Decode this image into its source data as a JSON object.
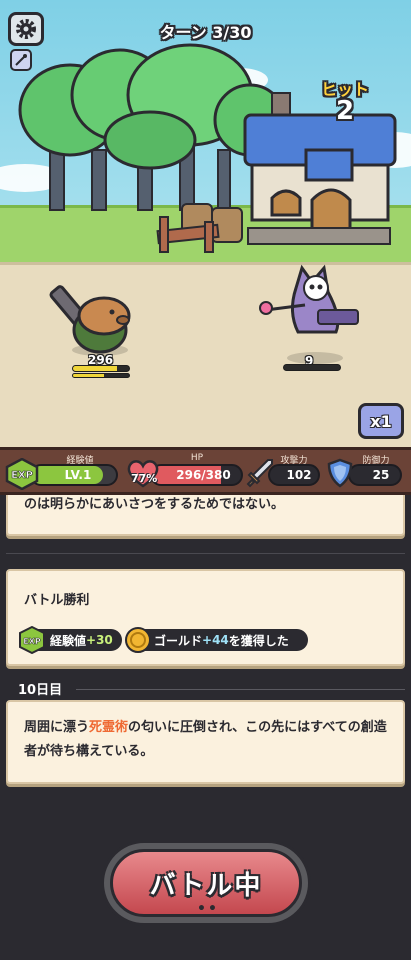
{
  "header": {
    "turn_label": "ターン 3/30",
    "hit_label": "ヒット",
    "hit_count": "2",
    "speed_label": "x1"
  },
  "units": {
    "player": {
      "hp_text": "296",
      "hp_fraction": 0.78
    },
    "enemy": {
      "hp_text": "9",
      "hp_fraction": 0.0
    }
  },
  "stats": {
    "exp_caption": "経験値",
    "exp_badge": "EXP",
    "level": "LV.1",
    "level_progress": 0.85,
    "hp_caption": "HP",
    "hp_value": "296/380",
    "hp_percent": "77%",
    "hp_fraction": 0.78,
    "attack_caption": "攻撃力",
    "attack_value": "102",
    "defense_caption": "防御力",
    "defense_value": "25"
  },
  "log": {
    "top_fragment": "のは明らかにあいさつをするためではない。",
    "battle_title": "バトル勝利",
    "reward_exp_badge": "EXP",
    "reward_exp_label": "経験値",
    "reward_exp_value": "+30",
    "reward_gold_label": "ゴールド",
    "reward_gold_value": "+44",
    "reward_gold_suffix": "を獲得した",
    "day_label": "10日目",
    "story_prefix": "周囲に漂う",
    "story_highlight": "死霊術",
    "story_suffix": "の匂いに圧倒され、この先にはすべての創造者が待ち構えている。"
  },
  "button": {
    "battle_label": "バトル中",
    "dots": "••"
  },
  "colors": {
    "accent_red": "#e05a5f",
    "exp_green": "#8cc63f",
    "highlight_orange": "#ef6a34",
    "gold_text": "#9fe1f7"
  },
  "icons": [
    "gear-icon",
    "tool-icon",
    "exp-icon",
    "heart-icon",
    "sword-icon",
    "shield-icon",
    "coin-icon"
  ]
}
